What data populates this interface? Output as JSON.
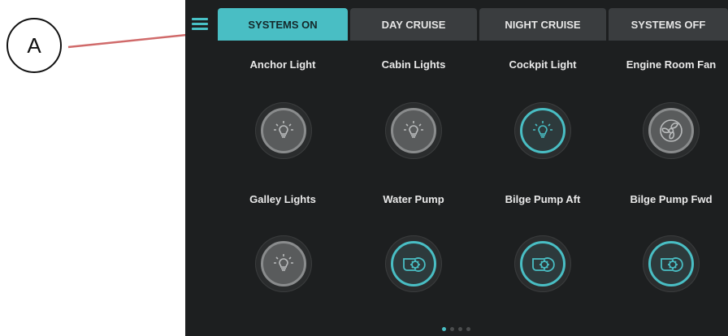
{
  "callout": {
    "label": "A"
  },
  "tabs": [
    {
      "label": "SYSTEMS ON",
      "active": true
    },
    {
      "label": "DAY CRUISE",
      "active": false
    },
    {
      "label": "NIGHT CRUISE",
      "active": false
    },
    {
      "label": "SYSTEMS OFF",
      "active": false
    }
  ],
  "controls": [
    {
      "label": "Anchor Light",
      "icon": "light-bulb-icon",
      "on": false
    },
    {
      "label": "Cabin Lights",
      "icon": "light-bulb-icon",
      "on": false
    },
    {
      "label": "Cockpit Light",
      "icon": "light-bulb-icon",
      "on": true
    },
    {
      "label": "Engine Room Fan",
      "icon": "fan-icon",
      "on": false
    },
    {
      "label": "Galley Lights",
      "icon": "light-bulb-icon",
      "on": false
    },
    {
      "label": "Water Pump",
      "icon": "pump-icon",
      "on": true
    },
    {
      "label": "Bilge Pump Aft",
      "icon": "pump-icon",
      "on": true
    },
    {
      "label": "Bilge Pump Fwd",
      "icon": "pump-icon",
      "on": true
    }
  ],
  "pager": {
    "pages": 4,
    "current": 1
  },
  "colors": {
    "accent": "#49bec4",
    "background": "#1d1f20",
    "callout_arrow": "#d06a6a"
  }
}
